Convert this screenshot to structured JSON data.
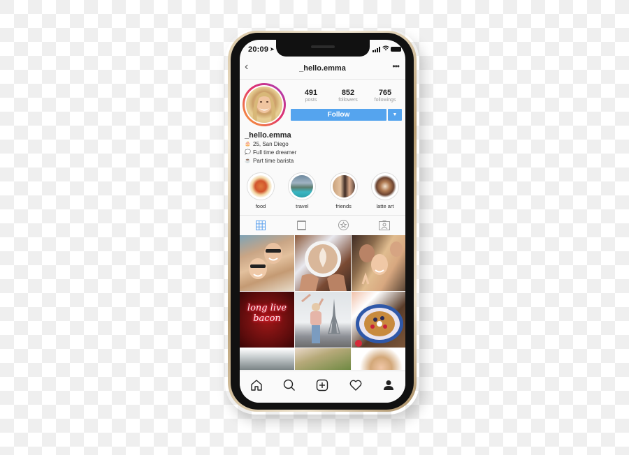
{
  "status_bar": {
    "time": "20:09"
  },
  "header": {
    "username": "_hello.emma"
  },
  "profile": {
    "stats": [
      {
        "value": "491",
        "label": "posts"
      },
      {
        "value": "852",
        "label": "followers"
      },
      {
        "value": "765",
        "label": "followings"
      }
    ],
    "follow_label": "Follow",
    "follow_dropdown_glyph": "▼",
    "bio": {
      "name": "_hello.emma",
      "lines": [
        {
          "emoji": "🎂",
          "text": "25, San Diego"
        },
        {
          "emoji": "💭",
          "text": "Full time dreamer"
        },
        {
          "emoji": "☕",
          "text": "Part time barista"
        }
      ]
    }
  },
  "highlights": [
    {
      "label": "food"
    },
    {
      "label": "travel"
    },
    {
      "label": "friends"
    },
    {
      "label": "latte art"
    }
  ],
  "profile_tabs": [
    "grid-icon",
    "feed-icon",
    "star-icon",
    "tagged-icon"
  ],
  "grid_posts": [
    {
      "subject": "two friends in sunglasses selfie"
    },
    {
      "subject": "latte art cup"
    },
    {
      "subject": "friends group selfie"
    },
    {
      "subject": "long live bacon neon sign"
    },
    {
      "subject": "woman at eiffel tower"
    },
    {
      "subject": "waffle with berries"
    },
    {
      "subject": "misty trees"
    },
    {
      "subject": "green hills"
    },
    {
      "subject": "blonde woman portrait"
    }
  ],
  "neon_text": "long live bacon",
  "bottom_nav": [
    "home-icon",
    "search-icon",
    "add-post-icon",
    "activity-heart-icon",
    "profile-icon"
  ],
  "colors": {
    "accent": "#55a4ee",
    "story_ring_start": "#f9a533",
    "story_ring_end": "#a23fc1"
  }
}
